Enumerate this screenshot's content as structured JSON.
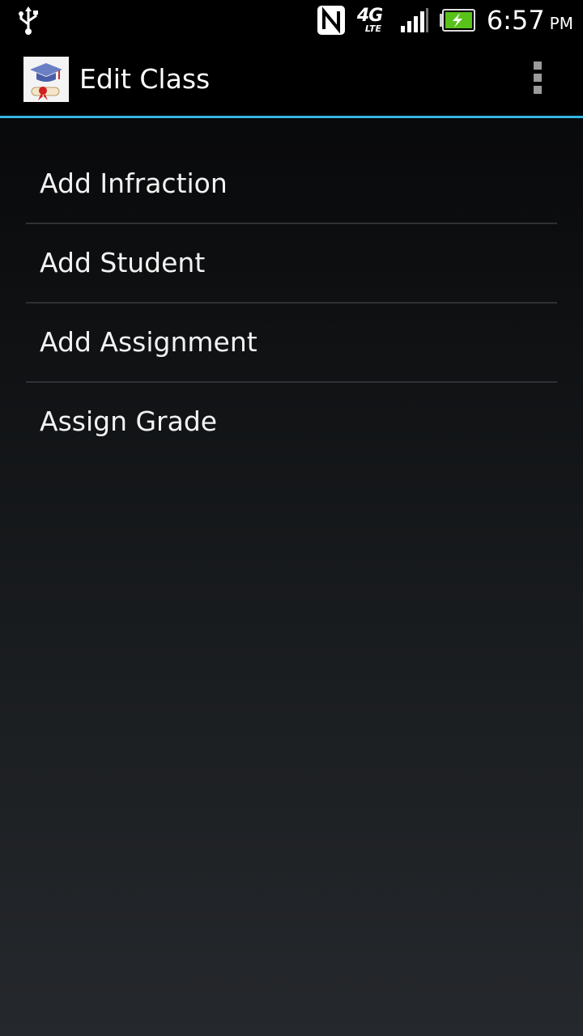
{
  "status_bar": {
    "time": "6:57",
    "ampm": "PM",
    "network_main": "4G",
    "network_sub": "LTE",
    "icons": [
      "usb-icon",
      "nfc-icon",
      "4g-lte-icon",
      "signal-icon",
      "battery-charging-icon"
    ]
  },
  "action_bar": {
    "title": "Edit Class",
    "app_icon": "graduation-cap-diploma-icon",
    "overflow_icon": "overflow-menu-icon",
    "accent_color": "#33b5e5"
  },
  "menu": {
    "items": [
      {
        "label": "Add Infraction"
      },
      {
        "label": "Add Student"
      },
      {
        "label": "Add Assignment"
      },
      {
        "label": "Assign Grade"
      }
    ]
  }
}
